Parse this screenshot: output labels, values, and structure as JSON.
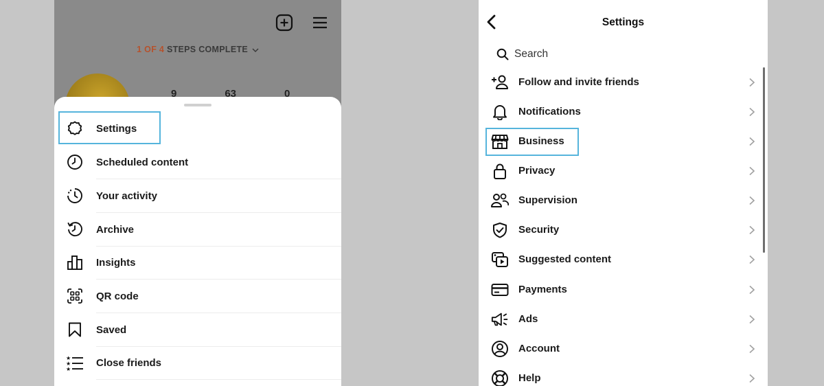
{
  "left_panel": {
    "profile_header": {
      "steps_prefix": "1 OF 4",
      "steps_suffix": " STEPS COMPLETE",
      "stats": [
        "9",
        "63",
        "0"
      ],
      "icons": [
        "add-post-icon",
        "hamburger-menu-icon"
      ]
    },
    "menu": {
      "items": [
        {
          "label": "Settings",
          "icon": "settings-gear-icon",
          "highlighted": true
        },
        {
          "label": "Scheduled content",
          "icon": "clock-icon"
        },
        {
          "label": "Your activity",
          "icon": "activity-icon"
        },
        {
          "label": "Archive",
          "icon": "archive-icon"
        },
        {
          "label": "Insights",
          "icon": "insights-bar-chart-icon"
        },
        {
          "label": "QR code",
          "icon": "qr-code-icon"
        },
        {
          "label": "Saved",
          "icon": "bookmark-icon"
        },
        {
          "label": "Close friends",
          "icon": "close-friends-list-icon"
        }
      ]
    }
  },
  "right_panel": {
    "title": "Settings",
    "search": {
      "label": "Search",
      "icon": "search-icon"
    },
    "items": [
      {
        "label": "Follow and invite friends",
        "icon": "add-person-icon"
      },
      {
        "label": "Notifications",
        "icon": "bell-icon"
      },
      {
        "label": "Business",
        "icon": "storefront-icon",
        "highlighted": true
      },
      {
        "label": "Privacy",
        "icon": "lock-icon"
      },
      {
        "label": "Supervision",
        "icon": "supervision-people-icon"
      },
      {
        "label": "Security",
        "icon": "shield-check-icon"
      },
      {
        "label": "Suggested content",
        "icon": "suggested-content-icon"
      },
      {
        "label": "Payments",
        "icon": "credit-card-icon"
      },
      {
        "label": "Ads",
        "icon": "megaphone-icon"
      },
      {
        "label": "Account",
        "icon": "account-circle-icon"
      },
      {
        "label": "Help",
        "icon": "help-lifebuoy-icon"
      }
    ]
  },
  "colors": {
    "highlight": "#55b4dc",
    "steps_accent": "#b5522d",
    "background": "#c6c6c6"
  }
}
